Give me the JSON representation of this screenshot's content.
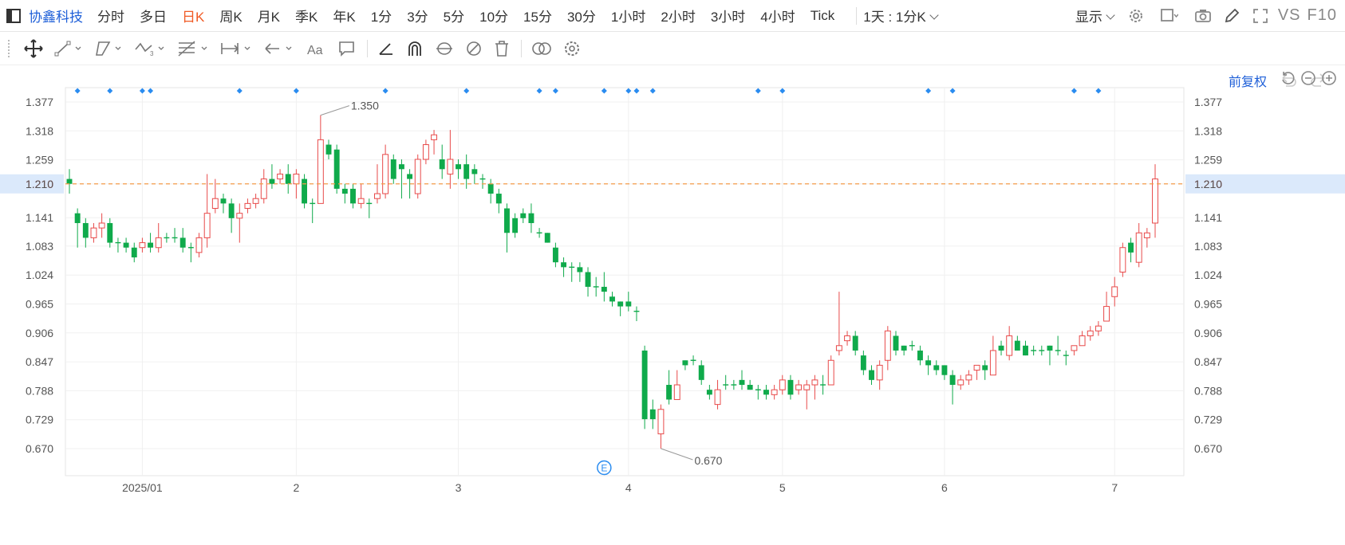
{
  "toolbar": {
    "symbol": "协鑫科技",
    "timeframes": [
      "分时",
      "多日",
      "日K",
      "周K",
      "月K",
      "季K",
      "年K",
      "1分",
      "3分",
      "5分",
      "10分",
      "15分",
      "30分",
      "1小时",
      "2小时",
      "3小时",
      "4小时",
      "Tick"
    ],
    "active_timeframe": "日K",
    "interval_label": "1天 : 1分K",
    "display_label": "显示",
    "vs_label": "VS",
    "f10_label": "F10"
  },
  "adjust_label": "前复权",
  "colors": {
    "up": "#e84a4a",
    "down": "#0faa4b",
    "price_line": "#f39c4a",
    "accent": "#1e5fd8",
    "marker": "#2a8cf0"
  },
  "chart_data": {
    "type": "candlestick",
    "y_ticks": [
      "1.377",
      "1.318",
      "1.259",
      "1.210",
      "1.141",
      "1.083",
      "1.024",
      "0.965",
      "0.906",
      "0.847",
      "0.788",
      "0.729",
      "0.670"
    ],
    "y_tick_values": [
      1.377,
      1.318,
      1.259,
      1.21,
      1.141,
      1.083,
      1.024,
      0.965,
      0.906,
      0.847,
      0.788,
      0.729,
      0.67
    ],
    "x_labels": [
      "2025/01",
      "2",
      "3",
      "4",
      "5",
      "6",
      "7"
    ],
    "x_label_index": [
      9,
      28,
      48,
      69,
      88,
      108,
      129
    ],
    "current_price": "1.210",
    "current_price_value": 1.21,
    "high_label": "1.350",
    "high_index": 31,
    "high_value": 1.35,
    "low_label": "0.670",
    "low_index": 73,
    "low_value": 0.67,
    "event_marker": "E",
    "event_index": 66,
    "marker_index": [
      1,
      5,
      9,
      10,
      21,
      28,
      39,
      49,
      58,
      60,
      66,
      69,
      70,
      72,
      85,
      88,
      106,
      109,
      124,
      127
    ],
    "candles": [
      [
        1.22,
        1.21,
        1.24,
        1.19
      ],
      [
        1.15,
        1.13,
        1.16,
        1.08
      ],
      [
        1.13,
        1.1,
        1.14,
        1.08
      ],
      [
        1.1,
        1.12,
        1.13,
        1.09
      ],
      [
        1.12,
        1.13,
        1.15,
        1.1
      ],
      [
        1.13,
        1.09,
        1.14,
        1.08
      ],
      [
        1.09,
        1.09,
        1.1,
        1.07
      ],
      [
        1.09,
        1.08,
        1.1,
        1.07
      ],
      [
        1.08,
        1.06,
        1.09,
        1.05
      ],
      [
        1.08,
        1.09,
        1.1,
        1.07
      ],
      [
        1.09,
        1.08,
        1.11,
        1.07
      ],
      [
        1.08,
        1.1,
        1.13,
        1.07
      ],
      [
        1.1,
        1.1,
        1.11,
        1.09
      ],
      [
        1.1,
        1.1,
        1.12,
        1.09
      ],
      [
        1.1,
        1.08,
        1.12,
        1.07
      ],
      [
        1.08,
        1.08,
        1.09,
        1.05
      ],
      [
        1.07,
        1.1,
        1.11,
        1.06
      ],
      [
        1.1,
        1.15,
        1.23,
        1.08
      ],
      [
        1.16,
        1.18,
        1.22,
        1.15
      ],
      [
        1.18,
        1.17,
        1.19,
        1.15
      ],
      [
        1.17,
        1.14,
        1.18,
        1.11
      ],
      [
        1.14,
        1.15,
        1.17,
        1.09
      ],
      [
        1.16,
        1.17,
        1.18,
        1.15
      ],
      [
        1.17,
        1.18,
        1.19,
        1.16
      ],
      [
        1.18,
        1.22,
        1.24,
        1.17
      ],
      [
        1.22,
        1.21,
        1.25,
        1.2
      ],
      [
        1.22,
        1.23,
        1.24,
        1.21
      ],
      [
        1.23,
        1.21,
        1.25,
        1.19
      ],
      [
        1.21,
        1.23,
        1.24,
        1.18
      ],
      [
        1.22,
        1.17,
        1.23,
        1.16
      ],
      [
        1.17,
        1.17,
        1.18,
        1.13
      ],
      [
        1.17,
        1.3,
        1.35,
        1.17
      ],
      [
        1.29,
        1.27,
        1.3,
        1.26
      ],
      [
        1.28,
        1.2,
        1.29,
        1.19
      ],
      [
        1.2,
        1.19,
        1.21,
        1.17
      ],
      [
        1.2,
        1.17,
        1.21,
        1.16
      ],
      [
        1.17,
        1.18,
        1.21,
        1.16
      ],
      [
        1.17,
        1.17,
        1.18,
        1.14
      ],
      [
        1.18,
        1.19,
        1.25,
        1.17
      ],
      [
        1.19,
        1.27,
        1.29,
        1.18
      ],
      [
        1.26,
        1.22,
        1.27,
        1.21
      ],
      [
        1.25,
        1.24,
        1.26,
        1.18
      ],
      [
        1.23,
        1.22,
        1.24,
        1.18
      ],
      [
        1.19,
        1.26,
        1.27,
        1.18
      ],
      [
        1.26,
        1.29,
        1.3,
        1.25
      ],
      [
        1.3,
        1.31,
        1.32,
        1.27
      ],
      [
        1.26,
        1.24,
        1.29,
        1.22
      ],
      [
        1.23,
        1.26,
        1.32,
        1.2
      ],
      [
        1.25,
        1.24,
        1.26,
        1.22
      ],
      [
        1.25,
        1.22,
        1.27,
        1.2
      ],
      [
        1.24,
        1.23,
        1.25,
        1.21
      ],
      [
        1.22,
        1.22,
        1.23,
        1.2
      ],
      [
        1.21,
        1.19,
        1.22,
        1.17
      ],
      [
        1.19,
        1.17,
        1.2,
        1.15
      ],
      [
        1.16,
        1.11,
        1.17,
        1.07
      ],
      [
        1.14,
        1.11,
        1.15,
        1.1
      ],
      [
        1.15,
        1.14,
        1.16,
        1.13
      ],
      [
        1.15,
        1.13,
        1.17,
        1.11
      ],
      [
        1.11,
        1.11,
        1.12,
        1.1
      ],
      [
        1.11,
        1.09,
        1.11,
        1.09
      ],
      [
        1.08,
        1.05,
        1.09,
        1.04
      ],
      [
        1.05,
        1.04,
        1.06,
        1.02
      ],
      [
        1.04,
        1.04,
        1.05,
        1.01
      ],
      [
        1.04,
        1.03,
        1.05,
        1.01
      ],
      [
        1.03,
        1.0,
        1.04,
        0.98
      ],
      [
        1.0,
        1.0,
        1.02,
        0.98
      ],
      [
        1.0,
        0.99,
        1.03,
        0.97
      ],
      [
        0.98,
        0.97,
        0.99,
        0.96
      ],
      [
        0.97,
        0.96,
        0.97,
        0.94
      ],
      [
        0.97,
        0.96,
        0.99,
        0.95
      ],
      [
        0.95,
        0.95,
        0.96,
        0.93
      ],
      [
        0.87,
        0.73,
        0.88,
        0.71
      ],
      [
        0.75,
        0.73,
        0.77,
        0.71
      ],
      [
        0.7,
        0.75,
        0.76,
        0.67
      ],
      [
        0.8,
        0.77,
        0.83,
        0.76
      ],
      [
        0.77,
        0.8,
        0.83,
        0.77
      ],
      [
        0.85,
        0.84,
        0.85,
        0.83
      ],
      [
        0.85,
        0.85,
        0.86,
        0.84
      ],
      [
        0.84,
        0.81,
        0.85,
        0.8
      ],
      [
        0.79,
        0.78,
        0.8,
        0.77
      ],
      [
        0.76,
        0.79,
        0.81,
        0.75
      ],
      [
        0.8,
        0.8,
        0.82,
        0.79
      ],
      [
        0.8,
        0.8,
        0.81,
        0.79
      ],
      [
        0.81,
        0.8,
        0.83,
        0.79
      ],
      [
        0.8,
        0.79,
        0.81,
        0.79
      ],
      [
        0.79,
        0.79,
        0.8,
        0.77
      ],
      [
        0.79,
        0.78,
        0.8,
        0.77
      ],
      [
        0.78,
        0.79,
        0.8,
        0.77
      ],
      [
        0.79,
        0.81,
        0.82,
        0.78
      ],
      [
        0.81,
        0.78,
        0.82,
        0.77
      ],
      [
        0.79,
        0.8,
        0.81,
        0.78
      ],
      [
        0.79,
        0.8,
        0.81,
        0.75
      ],
      [
        0.8,
        0.81,
        0.82,
        0.77
      ],
      [
        0.8,
        0.8,
        0.82,
        0.78
      ],
      [
        0.8,
        0.85,
        0.86,
        0.8
      ],
      [
        0.87,
        0.88,
        0.99,
        0.86
      ],
      [
        0.89,
        0.9,
        0.91,
        0.88
      ],
      [
        0.9,
        0.87,
        0.91,
        0.86
      ],
      [
        0.86,
        0.83,
        0.87,
        0.82
      ],
      [
        0.83,
        0.81,
        0.84,
        0.8
      ],
      [
        0.81,
        0.84,
        0.85,
        0.79
      ],
      [
        0.85,
        0.91,
        0.92,
        0.83
      ],
      [
        0.9,
        0.87,
        0.91,
        0.86
      ],
      [
        0.88,
        0.87,
        0.88,
        0.86
      ],
      [
        0.88,
        0.88,
        0.89,
        0.87
      ],
      [
        0.87,
        0.85,
        0.88,
        0.84
      ],
      [
        0.85,
        0.84,
        0.86,
        0.82
      ],
      [
        0.84,
        0.83,
        0.85,
        0.82
      ],
      [
        0.84,
        0.82,
        0.84,
        0.81
      ],
      [
        0.82,
        0.8,
        0.83,
        0.76
      ],
      [
        0.8,
        0.81,
        0.82,
        0.79
      ],
      [
        0.81,
        0.82,
        0.83,
        0.8
      ],
      [
        0.83,
        0.84,
        0.84,
        0.81
      ],
      [
        0.84,
        0.83,
        0.85,
        0.81
      ],
      [
        0.82,
        0.87,
        0.9,
        0.82
      ],
      [
        0.88,
        0.87,
        0.89,
        0.86
      ],
      [
        0.86,
        0.9,
        0.92,
        0.85
      ],
      [
        0.89,
        0.87,
        0.9,
        0.87
      ],
      [
        0.88,
        0.86,
        0.89,
        0.86
      ],
      [
        0.87,
        0.87,
        0.88,
        0.86
      ],
      [
        0.87,
        0.87,
        0.88,
        0.86
      ],
      [
        0.88,
        0.87,
        0.88,
        0.84
      ],
      [
        0.87,
        0.87,
        0.9,
        0.86
      ],
      [
        0.86,
        0.86,
        0.87,
        0.84
      ],
      [
        0.87,
        0.88,
        0.88,
        0.86
      ],
      [
        0.88,
        0.9,
        0.91,
        0.88
      ],
      [
        0.9,
        0.91,
        0.92,
        0.89
      ],
      [
        0.91,
        0.92,
        0.93,
        0.9
      ],
      [
        0.93,
        0.96,
        0.99,
        0.93
      ],
      [
        0.98,
        1.0,
        1.02,
        0.96
      ],
      [
        1.03,
        1.08,
        1.09,
        1.02
      ],
      [
        1.09,
        1.07,
        1.1,
        1.05
      ],
      [
        1.05,
        1.11,
        1.13,
        1.04
      ],
      [
        1.1,
        1.11,
        1.12,
        1.08
      ],
      [
        1.13,
        1.22,
        1.25,
        1.1
      ]
    ]
  }
}
